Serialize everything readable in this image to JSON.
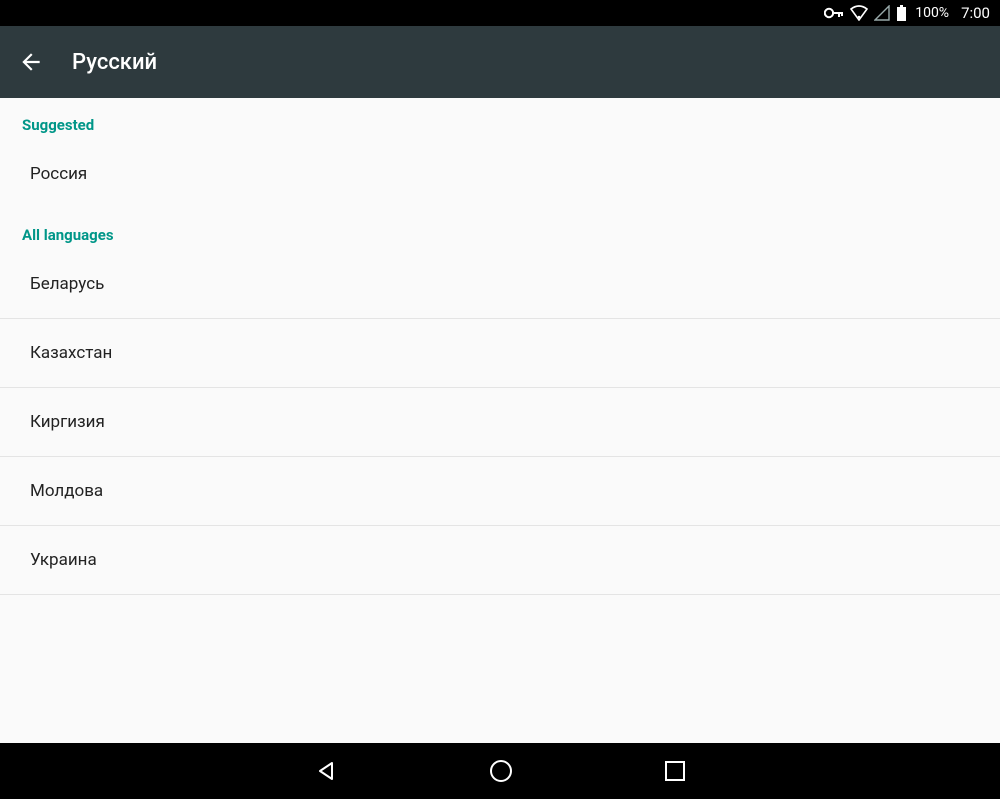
{
  "statusbar": {
    "battery_pct": "100%",
    "clock": "7:00"
  },
  "appbar": {
    "title": "Русский"
  },
  "sections": {
    "suggested": {
      "header": "Suggested",
      "items": [
        "Россия"
      ]
    },
    "all": {
      "header": "All languages",
      "items": [
        "Беларусь",
        "Казахстан",
        "Киргизия",
        "Молдова",
        "Украина"
      ]
    }
  }
}
